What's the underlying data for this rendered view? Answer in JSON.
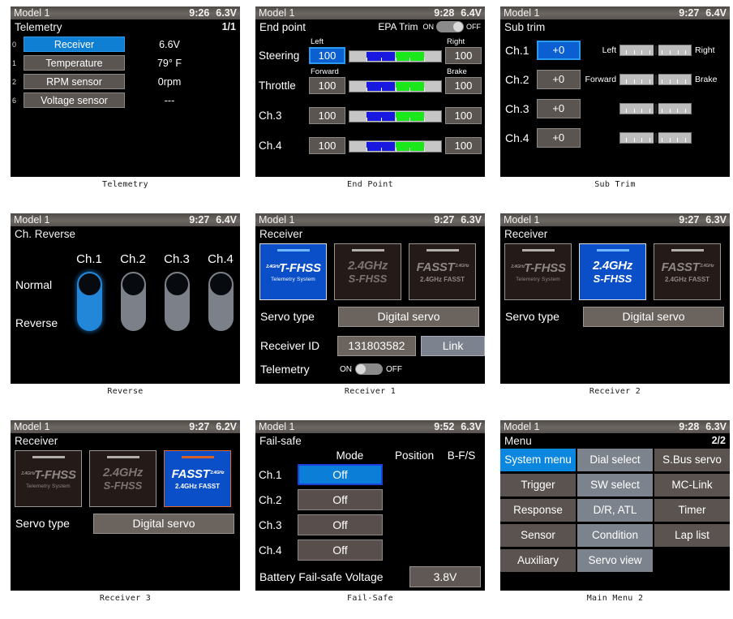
{
  "panels": [
    {
      "caption": "Telemetry",
      "header": {
        "model": "Model 1",
        "time": "9:26",
        "voltage": "6.3V"
      },
      "title": "Telemetry",
      "page": "1/1",
      "rows": [
        {
          "index": "0",
          "label": "Receiver",
          "value": "6.6V",
          "selected": true
        },
        {
          "index": "1",
          "label": "Temperature",
          "value": "79° F",
          "selected": false
        },
        {
          "index": "2",
          "label": "RPM sensor",
          "value": "0rpm",
          "selected": false
        },
        {
          "index": "6",
          "label": "Voltage sensor",
          "value": "---",
          "selected": false
        }
      ]
    },
    {
      "caption": "End Point",
      "header": {
        "model": "Model 1",
        "time": "9:28",
        "voltage": "6.4V"
      },
      "title": "End point",
      "epa_label": "EPA Trim",
      "toggle": {
        "on": "ON",
        "off": "OFF",
        "state": "OFF"
      },
      "rows": [
        {
          "name": "Steering",
          "left_label": "Left",
          "right_label": "Right",
          "left_value": "100",
          "right_value": "100",
          "selected": true
        },
        {
          "name": "Throttle",
          "left_label": "Forward",
          "right_label": "Brake",
          "left_value": "100",
          "right_value": "100",
          "selected": false
        },
        {
          "name": "Ch.3",
          "left_label": "",
          "right_label": "",
          "left_value": "100",
          "right_value": "100",
          "selected": false
        },
        {
          "name": "Ch.4",
          "left_label": "",
          "right_label": "",
          "left_value": "100",
          "right_value": "100",
          "selected": false
        }
      ]
    },
    {
      "caption": "Sub Trim",
      "header": {
        "model": "Model 1",
        "time": "9:27",
        "voltage": "6.4V"
      },
      "title": "Sub trim",
      "rows": [
        {
          "name": "Ch.1",
          "value": "+0",
          "left_label": "Left",
          "right_label": "Right",
          "selected": true
        },
        {
          "name": "Ch.2",
          "value": "+0",
          "left_label": "Forward",
          "right_label": "Brake",
          "selected": false
        },
        {
          "name": "Ch.3",
          "value": "+0",
          "left_label": "",
          "right_label": "",
          "selected": false
        },
        {
          "name": "Ch.4",
          "value": "+0",
          "left_label": "",
          "right_label": "",
          "selected": false
        }
      ]
    },
    {
      "caption": "Reverse",
      "header": {
        "model": "Model 1",
        "time": "9:27",
        "voltage": "6.4V"
      },
      "title": "Ch. Reverse",
      "normal_label": "Normal",
      "reverse_label": "Reverse",
      "channels": [
        {
          "name": "Ch.1",
          "state": "Normal",
          "selected": true
        },
        {
          "name": "Ch.2",
          "state": "Normal",
          "selected": false
        },
        {
          "name": "Ch.3",
          "state": "Normal",
          "selected": false
        },
        {
          "name": "Ch.4",
          "state": "Normal",
          "selected": false
        }
      ]
    },
    {
      "caption": "Receiver 1",
      "header": {
        "model": "Model 1",
        "time": "9:27",
        "voltage": "6.3V"
      },
      "title": "Receiver",
      "selected_system": "T-FHSS",
      "servo_type_label": "Servo type",
      "servo_type_value": "Digital servo",
      "receiver_id_label": "Receiver ID",
      "receiver_id_value": "131803582",
      "link_label": "Link",
      "telemetry_label": "Telemetry",
      "telemetry_toggle": {
        "on": "ON",
        "off": "OFF",
        "state": "OFF"
      }
    },
    {
      "caption": "Receiver 2",
      "header": {
        "model": "Model 1",
        "time": "9:27",
        "voltage": "6.3V"
      },
      "title": "Receiver",
      "selected_system": "S-FHSS",
      "servo_type_label": "Servo type",
      "servo_type_value": "Digital servo"
    },
    {
      "caption": "Receiver 3",
      "header": {
        "model": "Model 1",
        "time": "9:27",
        "voltage": "6.2V"
      },
      "title": "Receiver",
      "selected_system": "FASST",
      "servo_type_label": "Servo type",
      "servo_type_value": "Digital servo"
    },
    {
      "caption": "Fail-Safe",
      "header": {
        "model": "Model 1",
        "time": "9:52",
        "voltage": "6.3V"
      },
      "title": "Fail-safe",
      "columns": [
        "Mode",
        "Position",
        "B-F/S"
      ],
      "rows": [
        {
          "name": "Ch.1",
          "mode": "Off",
          "selected": true
        },
        {
          "name": "Ch.2",
          "mode": "Off",
          "selected": false
        },
        {
          "name": "Ch.3",
          "mode": "Off",
          "selected": false
        },
        {
          "name": "Ch.4",
          "mode": "Off",
          "selected": false
        }
      ],
      "battery_label": "Battery Fail-safe Voltage",
      "battery_value": "3.8V"
    },
    {
      "caption": "Main Menu 2",
      "header": {
        "model": "Model 1",
        "time": "9:28",
        "voltage": "6.3V"
      },
      "title": "Menu",
      "page": "2/2",
      "buttons": [
        [
          {
            "label": "System menu",
            "style": "sel"
          },
          {
            "label": "Dial select",
            "style": "alt"
          },
          {
            "label": "S.Bus servo",
            "style": "dark"
          }
        ],
        [
          {
            "label": "Trigger",
            "style": "dark"
          },
          {
            "label": "SW select",
            "style": "alt"
          },
          {
            "label": "MC-Link",
            "style": "dark"
          }
        ],
        [
          {
            "label": "Response",
            "style": "dark"
          },
          {
            "label": "D/R, ATL",
            "style": "alt"
          },
          {
            "label": "Timer",
            "style": "dark"
          }
        ],
        [
          {
            "label": "Sensor",
            "style": "dark"
          },
          {
            "label": "Condition",
            "style": "alt"
          },
          {
            "label": "Lap list",
            "style": "dark"
          }
        ],
        [
          {
            "label": "Auxiliary",
            "style": "dark"
          },
          {
            "label": "Servo view",
            "style": "alt"
          },
          {
            "label": "",
            "style": "empty"
          }
        ]
      ]
    }
  ],
  "rx_tiles": {
    "tfhss": {
      "brand": "T-FHSS",
      "freq": "2.4GHz",
      "sub": "Telemetry System"
    },
    "sfhss": {
      "brand": "2.4GHz",
      "brand2": "S-FHSS"
    },
    "fasst": {
      "brand": "FASST",
      "freq": "2.4GHz",
      "sub": "2.4GHz FASST"
    }
  }
}
